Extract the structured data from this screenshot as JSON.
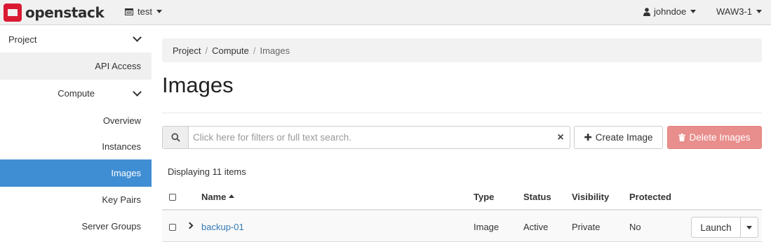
{
  "header": {
    "brand": "openstack",
    "project": "test",
    "user": "johndoe",
    "region": "WAW3-1",
    "brand_color": "#da1a32"
  },
  "sidebar": {
    "items": [
      {
        "label": "Project"
      },
      {
        "label": "API Access"
      },
      {
        "label": "Compute"
      },
      {
        "label": "Overview"
      },
      {
        "label": "Instances"
      },
      {
        "label": "Images"
      },
      {
        "label": "Key Pairs"
      },
      {
        "label": "Server Groups"
      }
    ],
    "active_color": "#3f8ed3"
  },
  "breadcrumb": [
    "Project",
    "Compute",
    "Images"
  ],
  "page_title": "Images",
  "search": {
    "placeholder": "Click here for filters or full text search.",
    "clear": "×"
  },
  "actions": {
    "create": "Create Image",
    "delete": "Delete Images"
  },
  "count_text": "Displaying 11 items",
  "table": {
    "columns": [
      "Name",
      "Type",
      "Status",
      "Visibility",
      "Protected"
    ],
    "rows": [
      {
        "name": "backup-01",
        "type": "Image",
        "status": "Active",
        "visibility": "Private",
        "protected": "No",
        "action": "Launch"
      }
    ]
  }
}
